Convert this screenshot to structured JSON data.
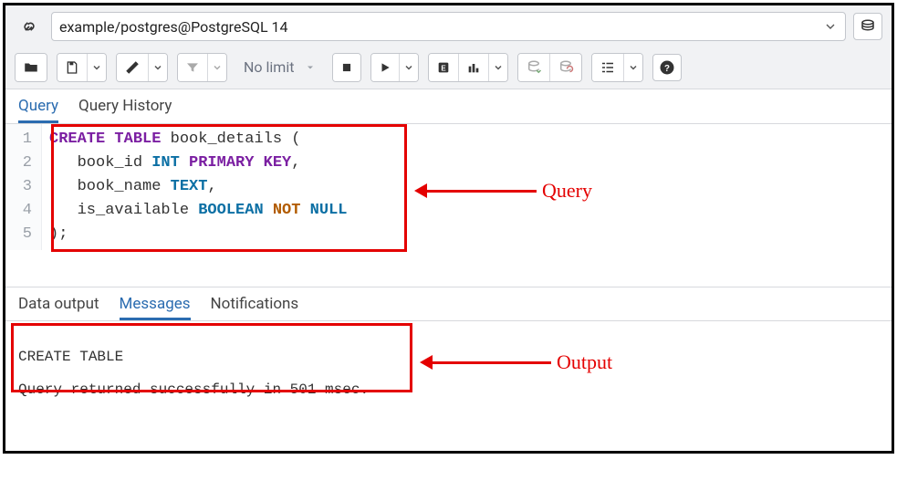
{
  "connection": {
    "text": "example/postgres@PostgreSQL 14"
  },
  "toolbar": {
    "limit_label": "No limit"
  },
  "editor_tabs": {
    "query": "Query",
    "history": "Query History"
  },
  "code": {
    "lines": [
      "1",
      "2",
      "3",
      "4",
      "5"
    ],
    "l1_kw1": "CREATE",
    "l1_kw2": "TABLE",
    "l1_rest": " book_details (",
    "l2_pre": "   book_id ",
    "l2_kw1": "INT",
    "l2_kw2": "PRIMARY",
    "l2_kw3": "KEY",
    "l2_rest": ",",
    "l3_pre": "   book_name ",
    "l3_kw1": "TEXT",
    "l3_rest": ",",
    "l4_pre": "   is_available ",
    "l4_kw1": "BOOLEAN",
    "l4_kw2": "NOT",
    "l4_kw3": "NULL",
    "l5": ");"
  },
  "output_tabs": {
    "data": "Data output",
    "messages": "Messages",
    "notifications": "Notifications"
  },
  "messages": {
    "line1": "CREATE TABLE",
    "line2": "Query returned successfully in 501 msec."
  },
  "annotations": {
    "query": "Query",
    "output": "Output"
  }
}
